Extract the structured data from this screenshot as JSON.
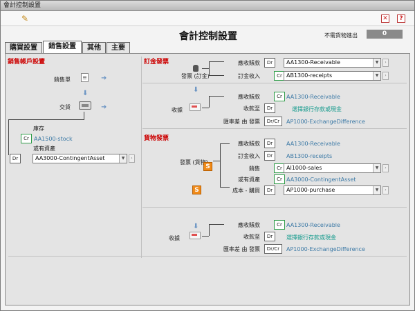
{
  "window": {
    "title": "會計控制設置"
  },
  "page_title": "會計控制設置",
  "no_stock": {
    "label": "不需貨物進出",
    "value": "0"
  },
  "tabs": [
    "購買設置",
    "銷售設置",
    "其他",
    "主要"
  ],
  "icons": {
    "pencil": "pencil-icon",
    "close": "close-icon",
    "help": "help-icon"
  },
  "left": {
    "header": "銷售帳戶設置",
    "sales_order": "銷售單",
    "delivery": "交貨",
    "inventory": {
      "label": "庫存",
      "badge": "Cr",
      "account": "AA1500-stock"
    },
    "contingent": {
      "label": "或有資產",
      "badge": "Dr",
      "account": "AA3000-ContingentAsset"
    }
  },
  "order_invoice": {
    "header": "訂金發票",
    "invoice_label": "發票 (訂金)",
    "receivable": {
      "label": "應收賬款",
      "badge": "Dr",
      "account": "AA1300-Receivable"
    },
    "receipts": {
      "label": "訂金收入",
      "badge": "Cr",
      "account": "AB1300-receipts"
    },
    "receipt_label": "收據",
    "r_receivable": {
      "label": "應收賬款",
      "badge": "Cr",
      "account": "AA1300-Receivable"
    },
    "r_received_to": {
      "label": "收款至",
      "badge": "Dr",
      "account": "選擇銀行存款或現金"
    },
    "r_fx": {
      "label": "匯率差 由 發票",
      "badge": "Dr/Cr",
      "account": "AP1000-ExchangeDifference"
    }
  },
  "goods_invoice": {
    "header": "貨物發票",
    "invoice_label": "發票 (貨物)",
    "receivable": {
      "label": "應收賬款",
      "badge": "Dr",
      "account": "AA1300-Receivable"
    },
    "receipts": {
      "label": "訂金收入",
      "badge": "Dr",
      "account": "AB1300-receipts"
    },
    "sales": {
      "label": "銷售",
      "badge": "Cr",
      "account": "AI1000-sales"
    },
    "contingent": {
      "label": "或有資產",
      "badge": "Cr",
      "account": "AA3000-ContingentAsset"
    },
    "cost": {
      "label": "成本 - 購買",
      "badge": "Dr",
      "account": "AP1000-purchase"
    },
    "receipt_label": "收據",
    "r_receivable": {
      "label": "應收賬款",
      "badge": "Cr",
      "account": "AA1300-Receivable"
    },
    "r_received_to": {
      "label": "收款至",
      "badge": "Dr",
      "account": "選擇銀行存款或現金"
    },
    "r_fx": {
      "label": "匯率差 由 發票",
      "badge": "Dr/Cr",
      "account": "AP1000-ExchangeDifference"
    }
  }
}
